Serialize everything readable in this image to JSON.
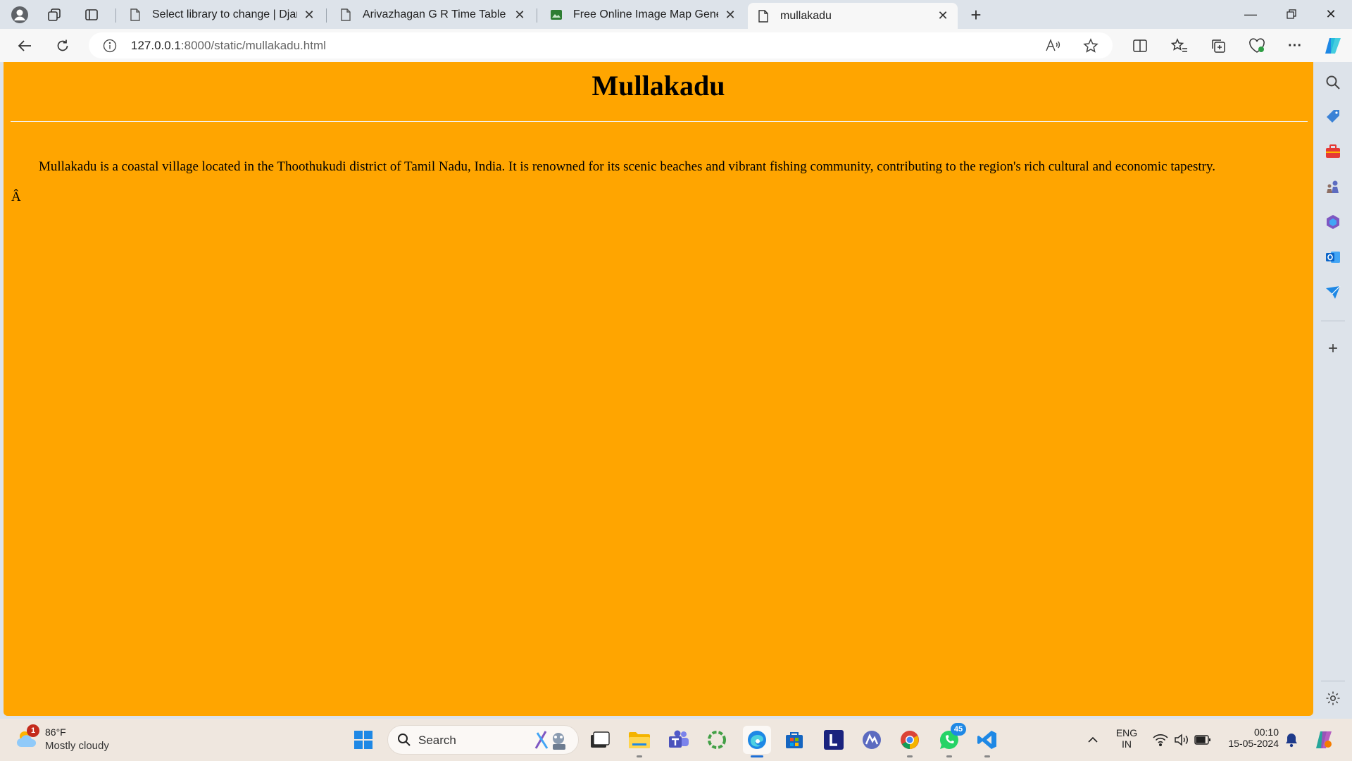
{
  "browser": {
    "tabs": [
      {
        "label": "Select library to change | Django",
        "favicon": "page-icon",
        "active": false
      },
      {
        "label": "Arivazhagan G R Time Table",
        "favicon": "page-icon",
        "active": false
      },
      {
        "label": "Free Online Image Map Generato",
        "favicon": "image-icon",
        "active": false
      },
      {
        "label": "mullakadu",
        "favicon": "page-icon",
        "active": true
      }
    ],
    "address": {
      "host": "127.0.0.1",
      "path": ":8000/static/mullakadu.html"
    }
  },
  "page": {
    "title": "Mullakadu",
    "description": "Mullakadu is a coastal village located in the Thoothukudi district of Tamil Nadu, India. It is renowned for its scenic beaches and vibrant fishing community, contributing to the region's rich cultural and economic tapestry.",
    "stray_char": "Â",
    "background": "#ffa500"
  },
  "taskbar": {
    "weather": {
      "temp": "86°F",
      "condition": "Mostly cloudy",
      "badge": "1"
    },
    "search_label": "Search",
    "whatsapp_badge": "45",
    "language": {
      "line1": "ENG",
      "line2": "IN"
    },
    "clock": {
      "time": "00:10",
      "date": "15-05-2024"
    }
  }
}
